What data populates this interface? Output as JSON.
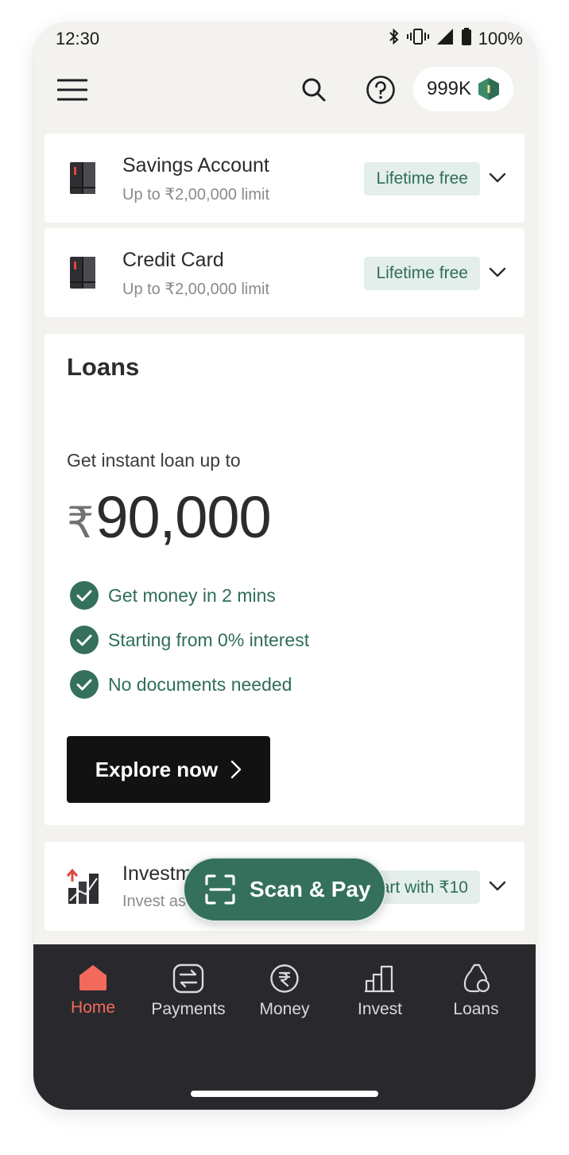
{
  "status_bar": {
    "time": "12:30",
    "battery": "100%"
  },
  "header": {
    "coins": "999K"
  },
  "products": [
    {
      "title": "Savings Account",
      "subtitle": "Up to ₹2,00,000 limit",
      "badge": "Lifetime free"
    },
    {
      "title": "Credit Card",
      "subtitle": "Up to ₹2,00,000 limit",
      "badge": "Lifetime free"
    }
  ],
  "loans": {
    "title": "Loans",
    "lead": "Get instant loan up to",
    "currency": "₹",
    "amount": "90,000",
    "features": [
      "Get money in 2 mins",
      "Starting from 0% interest",
      "No documents needed"
    ],
    "cta": "Explore now"
  },
  "investments": {
    "title": "Investments",
    "subtitle": "Invest as low as",
    "badge": "Start with ₹10"
  },
  "scan_pay": {
    "label": "Scan & Pay"
  },
  "bottom_nav": [
    {
      "label": "Home",
      "icon": "home-icon",
      "active": true
    },
    {
      "label": "Payments",
      "icon": "payments-icon",
      "active": false
    },
    {
      "label": "Money",
      "icon": "rupee-icon",
      "active": false
    },
    {
      "label": "Invest",
      "icon": "invest-icon",
      "active": false
    },
    {
      "label": "Loans",
      "icon": "loan-bag-icon",
      "active": false
    }
  ],
  "colors": {
    "brand_green": "#34705b",
    "accent_red": "#f26a5b",
    "nav_bg": "#29292d",
    "page_bg": "#f3f2ee"
  }
}
